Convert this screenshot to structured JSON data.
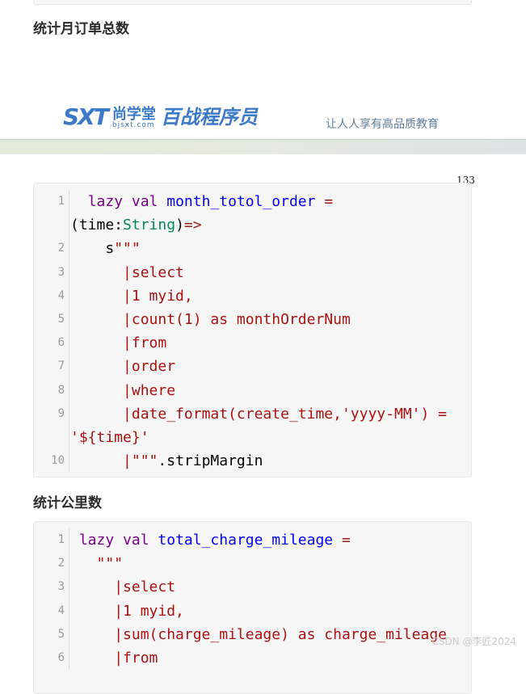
{
  "headings": {
    "monthly_orders": "统计月订单总数",
    "mileage": "统计公里数"
  },
  "banner": {
    "logo_brand": "SXT",
    "logo_cn": "尚学堂",
    "logo_url": "bjsxt.com",
    "logo_product": "百战程序员",
    "slogan": "让人人享有高品质教育"
  },
  "page_number": "133",
  "code_blocks": [
    {
      "lines": [
        {
          "n": "1",
          "t": [
            [
              "plain",
              "  "
            ],
            [
              "kw",
              "lazy"
            ],
            [
              "plain",
              " "
            ],
            [
              "kw",
              "val"
            ],
            [
              "plain",
              " "
            ],
            [
              "def",
              "month_totol_order"
            ],
            [
              "plain",
              " "
            ],
            [
              "op",
              "="
            ],
            [
              "plain",
              " (time:"
            ],
            [
              "type",
              "String"
            ],
            [
              "plain",
              ")"
            ],
            [
              "op",
              "=>"
            ]
          ]
        },
        {
          "n": "2",
          "t": [
            [
              "plain",
              "    s"
            ],
            [
              "str",
              "\"\"\""
            ]
          ]
        },
        {
          "n": "3",
          "t": [
            [
              "str",
              "      |select"
            ]
          ]
        },
        {
          "n": "4",
          "t": [
            [
              "str",
              "      |1 myid,"
            ]
          ]
        },
        {
          "n": "5",
          "t": [
            [
              "str",
              "      |count(1) as monthOrderNum"
            ]
          ]
        },
        {
          "n": "6",
          "t": [
            [
              "str",
              "      |from"
            ]
          ]
        },
        {
          "n": "7",
          "t": [
            [
              "str",
              "      |order"
            ]
          ]
        },
        {
          "n": "8",
          "t": [
            [
              "str",
              "      |where"
            ]
          ]
        },
        {
          "n": "9",
          "t": [
            [
              "str",
              "      |date_format(create_time,'yyyy-MM') = '${time}'"
            ]
          ]
        },
        {
          "n": "10",
          "t": [
            [
              "str",
              "      |\"\"\""
            ],
            [
              "plain",
              ".stripMargin"
            ]
          ]
        }
      ]
    },
    {
      "lines": [
        {
          "n": "1",
          "t": [
            [
              "plain",
              " "
            ],
            [
              "kw",
              "lazy"
            ],
            [
              "plain",
              " "
            ],
            [
              "kw",
              "val"
            ],
            [
              "plain",
              " "
            ],
            [
              "def",
              "total_charge_mileage"
            ],
            [
              "plain",
              " "
            ],
            [
              "op",
              "="
            ]
          ]
        },
        {
          "n": "2",
          "t": [
            [
              "str",
              "   \"\"\""
            ]
          ]
        },
        {
          "n": "3",
          "t": [
            [
              "str",
              "     |select"
            ]
          ]
        },
        {
          "n": "4",
          "t": [
            [
              "str",
              "     |1 myid,"
            ]
          ]
        },
        {
          "n": "5",
          "t": [
            [
              "str",
              "     |sum(charge_mileage) as charge_mileage"
            ]
          ]
        },
        {
          "n": "6",
          "t": [
            [
              "str",
              "     |from"
            ]
          ]
        }
      ]
    }
  ],
  "watermark": "CSDN @李匠2024"
}
